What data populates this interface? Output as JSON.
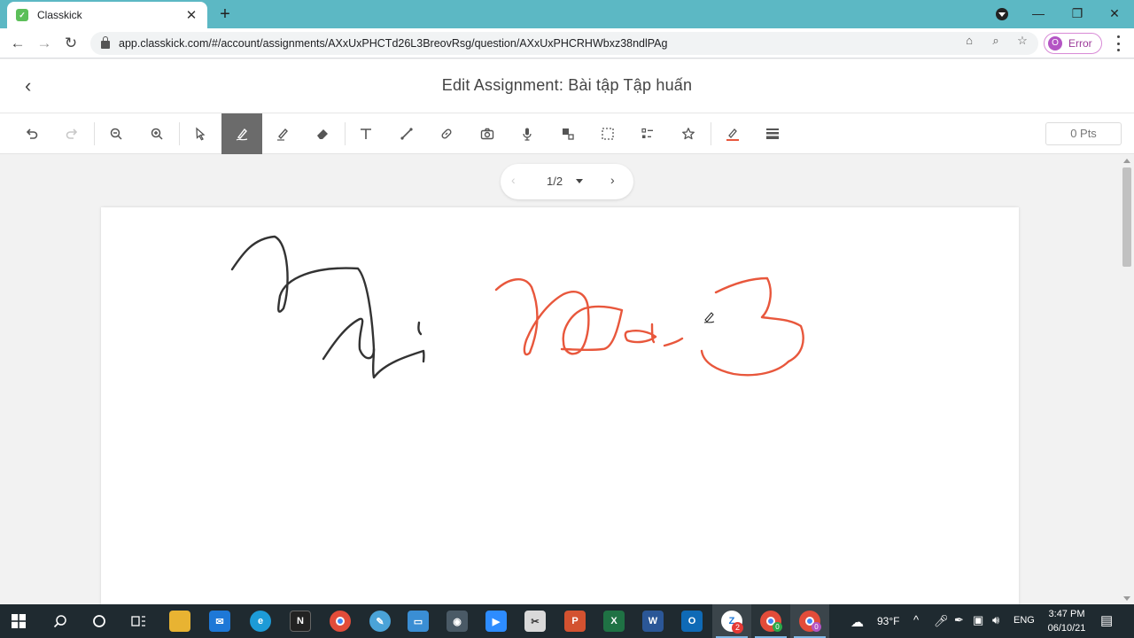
{
  "browser": {
    "tab_title": "Classkick",
    "url": "app.classkick.com/#/account/assignments/AXxUxPHCTd26L3BreovRsg/question/AXxUxPHCRHWbxz38ndlPAg",
    "profile_initial": "O",
    "profile_status": "Error"
  },
  "app": {
    "title": "Edit Assignment: Bài tập Tập huấn",
    "points": "0 Pts",
    "page_indicator": "1/2",
    "pen_color": "#e8573c",
    "ink_color": "#333333"
  },
  "toolbar": {
    "tools": [
      {
        "name": "undo",
        "icon": "undo-icon"
      },
      {
        "name": "redo",
        "icon": "redo-icon"
      },
      {
        "name": "zoom-out",
        "icon": "zoom-out-icon"
      },
      {
        "name": "zoom-in",
        "icon": "zoom-in-icon"
      },
      {
        "name": "select",
        "icon": "cursor-icon"
      },
      {
        "name": "pen",
        "icon": "pen-icon",
        "active": true
      },
      {
        "name": "highlighter",
        "icon": "highlighter-icon"
      },
      {
        "name": "eraser",
        "icon": "eraser-icon"
      },
      {
        "name": "text",
        "icon": "text-icon"
      },
      {
        "name": "line",
        "icon": "line-icon"
      },
      {
        "name": "link",
        "icon": "link-icon"
      },
      {
        "name": "camera",
        "icon": "camera-icon"
      },
      {
        "name": "microphone",
        "icon": "microphone-icon"
      },
      {
        "name": "shapes",
        "icon": "shapes-icon"
      },
      {
        "name": "selection-area",
        "icon": "dotted-square-icon"
      },
      {
        "name": "multiple-choice",
        "icon": "list-icon"
      },
      {
        "name": "sticker",
        "icon": "star-icon"
      },
      {
        "name": "pen-color",
        "icon": "pen-color-icon"
      },
      {
        "name": "line-weight",
        "icon": "line-weight-icon"
      }
    ]
  },
  "taskbar": {
    "weather": "93°F",
    "language": "ENG",
    "time": "3:47 PM",
    "date": "06/10/21",
    "zoom_badge": "2",
    "chrome_badge_1": "0",
    "chrome_badge_2": "0"
  }
}
